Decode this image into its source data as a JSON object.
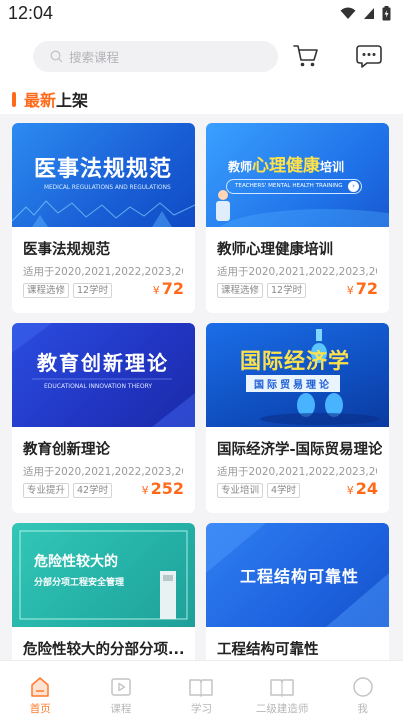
{
  "status_bar": {
    "time": "12:04"
  },
  "search": {
    "placeholder": "搜索课程"
  },
  "section": {
    "title_accent": "最新",
    "title_rest": "上架"
  },
  "courses": [
    {
      "thumb_title": "医事法规规范",
      "thumb_sub": "MEDICAL REGULATIONS AND REGULATIONS",
      "title": "医事法规规范",
      "years": "适用于2020,2021,2022,2023,20...",
      "tags": [
        "课程选修",
        "12学时"
      ],
      "price": "72"
    },
    {
      "thumb_title_a": "教师",
      "thumb_title_b": "心理健康",
      "thumb_title_c": "培训",
      "thumb_sub": "TEACHERS' MENTAL HEALTH TRAINING",
      "title": "教师心理健康培训",
      "years": "适用于2020,2021,2022,2023,20...",
      "tags": [
        "课程选修",
        "12学时"
      ],
      "price": "72"
    },
    {
      "thumb_title": "教育创新理论",
      "thumb_sub": "EDUCATIONAL INNOVATION THEORY",
      "title": "教育创新理论",
      "years": "适用于2020,2021,2022,2023,20...",
      "tags": [
        "专业提升",
        "42学时"
      ],
      "price": "252"
    },
    {
      "thumb_title": "国际经济学",
      "thumb_sub": "国际贸易理论",
      "title": "国际经济学-国际贸易理论",
      "years": "适用于2020,2021,2022,2023,20...",
      "tags": [
        "专业培训",
        "4学时"
      ],
      "price": "24"
    },
    {
      "thumb_title": "危险性较大的",
      "thumb_sub": "分部分项工程安全管理",
      "title": "危险性较大的分部分项...",
      "years": "",
      "tags": [],
      "price": ""
    },
    {
      "thumb_title": "工程结构可靠性",
      "title": "工程结构可靠性",
      "years": "",
      "tags": [],
      "price": ""
    }
  ],
  "currency": "¥",
  "tabs": [
    {
      "label": "首页",
      "icon": "home-icon",
      "active": true
    },
    {
      "label": "课程",
      "icon": "play-icon",
      "active": false
    },
    {
      "label": "学习",
      "icon": "book-icon",
      "active": false
    },
    {
      "label": "二级建造师",
      "icon": "book-icon",
      "active": false
    },
    {
      "label": "我",
      "icon": "user-icon",
      "active": false
    }
  ],
  "colors": {
    "accent": "#ff6a1a",
    "blue": "#1f6fe8"
  }
}
